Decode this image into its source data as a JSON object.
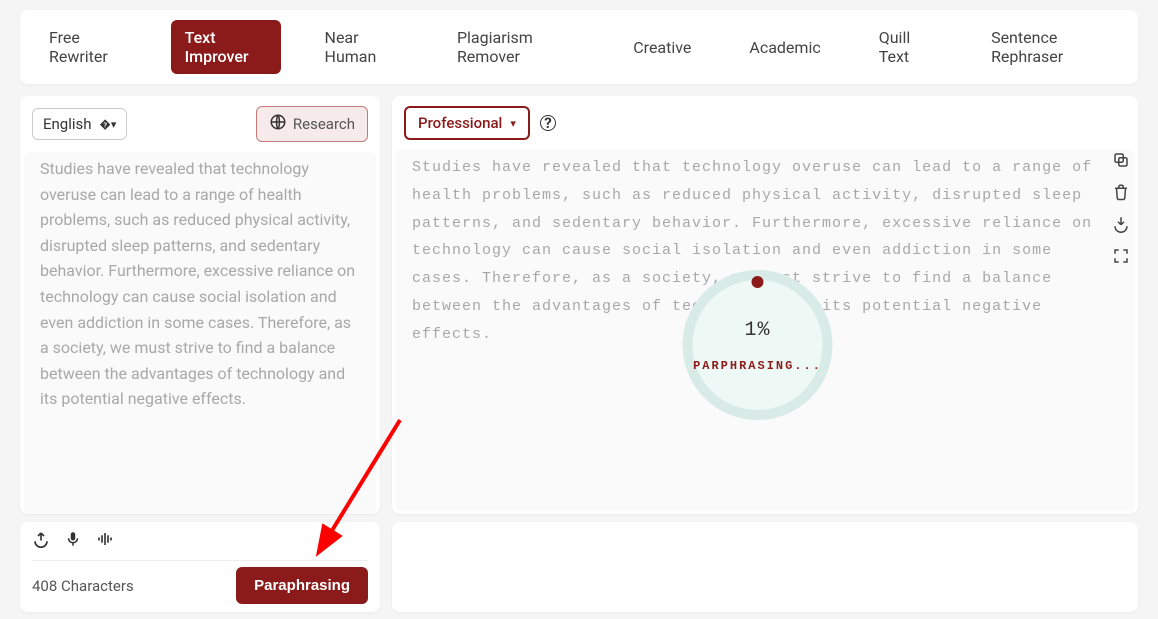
{
  "tabs": {
    "items": [
      "Free Rewriter",
      "Text Improver",
      "Near Human",
      "Plagiarism Remover",
      "Creative",
      "Academic",
      "Quill Text",
      "Sentence Rephraser"
    ],
    "active_index": 1
  },
  "left": {
    "language": "English",
    "research_label": "Research",
    "text": "Studies have revealed that technology overuse can lead to a range of health problems, such as reduced physical activity, disrupted sleep patterns, and sedentary behavior. Furthermore, excessive reliance on technology can cause social isolation and even addiction in some cases. Therefore, as a society, we must strive to find a balance between the advantages of technology and its potential negative effects."
  },
  "right": {
    "style": "Professional",
    "text": "Studies have revealed that technology overuse can lead to a range of health problems, such as reduced physical activity, disrupted sleep patterns, and sedentary behavior. Furthermore, excessive reliance on technology can cause social isolation and even addiction in some cases. Therefore, as a society, we must strive to find a balance between the advantages of technology and its potential negative effects."
  },
  "progress": {
    "percent": "1%",
    "label": "PARPHRASING..."
  },
  "footer": {
    "char_count": "408 Characters",
    "button": "Paraphrasing"
  }
}
